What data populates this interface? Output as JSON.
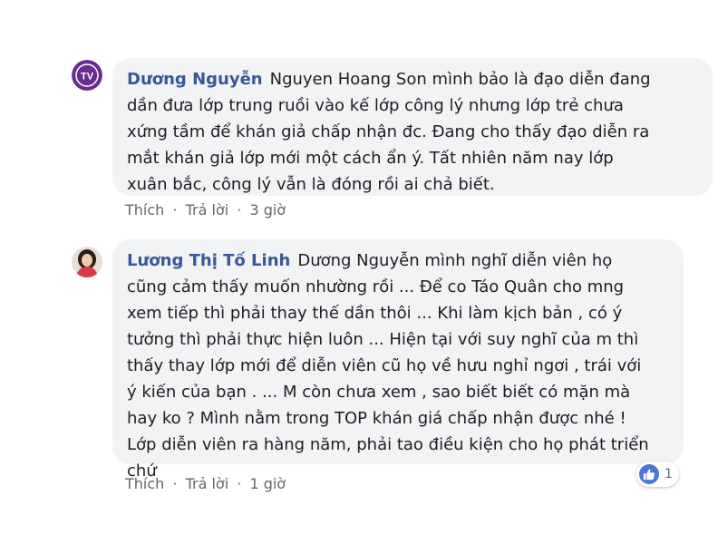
{
  "comments": [
    {
      "author": "Dương Nguyễn",
      "text_lines": [
        "Nguyen Hoang Son mình bảo là đạo diễn đang",
        "dần đưa lớp trung ruồi vào kế lớp công lý nhưng lớp trẻ chưa",
        "xứng tầm để khán giả chấp nhận đc. Đang cho thấy đạo diễn ra",
        "mắt khán giả lớp mới một cách ẩn ý. Tất nhiên năm nay lớp",
        "xuân bắc, công lý vẫn là đóng rồi ai chả biết."
      ],
      "like_label": "Thích",
      "reply_label": "Trả lời",
      "separator": "·",
      "time": "3 giờ",
      "avatar_text": "TV",
      "avatar_color": "#6a2c91"
    },
    {
      "author": "Lương Thị Tố Linh",
      "text_lines": [
        "Dương Nguyễn mình nghĩ diễn viên họ",
        "cũng cảm thấy muốn nhường rồi ... Để co Táo Quân cho mng",
        "xem tiếp thì phải thay thế dần thôi ... Khi làm kịch bản , có ý",
        "tưởng thì phải thực hiện luôn ... Hiện tại với suy nghĩ của m thì",
        "thấy thay lớp mới để diễn viên cũ họ về hưu nghỉ ngơi , trái với",
        "ý kiến của bạn . ... M còn chưa xem , sao biết biết có mặn mà",
        "hay ko ? Mình nằm trong TOP khán giá chấp nhận được nhé !",
        "Lớp diễn viên ra hàng năm, phải tao điều kiện cho họ phát triển",
        "chứ"
      ],
      "like_label": "Thích",
      "reply_label": "Trả lời",
      "separator": "·",
      "time": "1 giờ",
      "reaction_count": "1",
      "reaction_icon": "thumbs-up-icon",
      "reaction_color": "#4a76d6"
    }
  ]
}
